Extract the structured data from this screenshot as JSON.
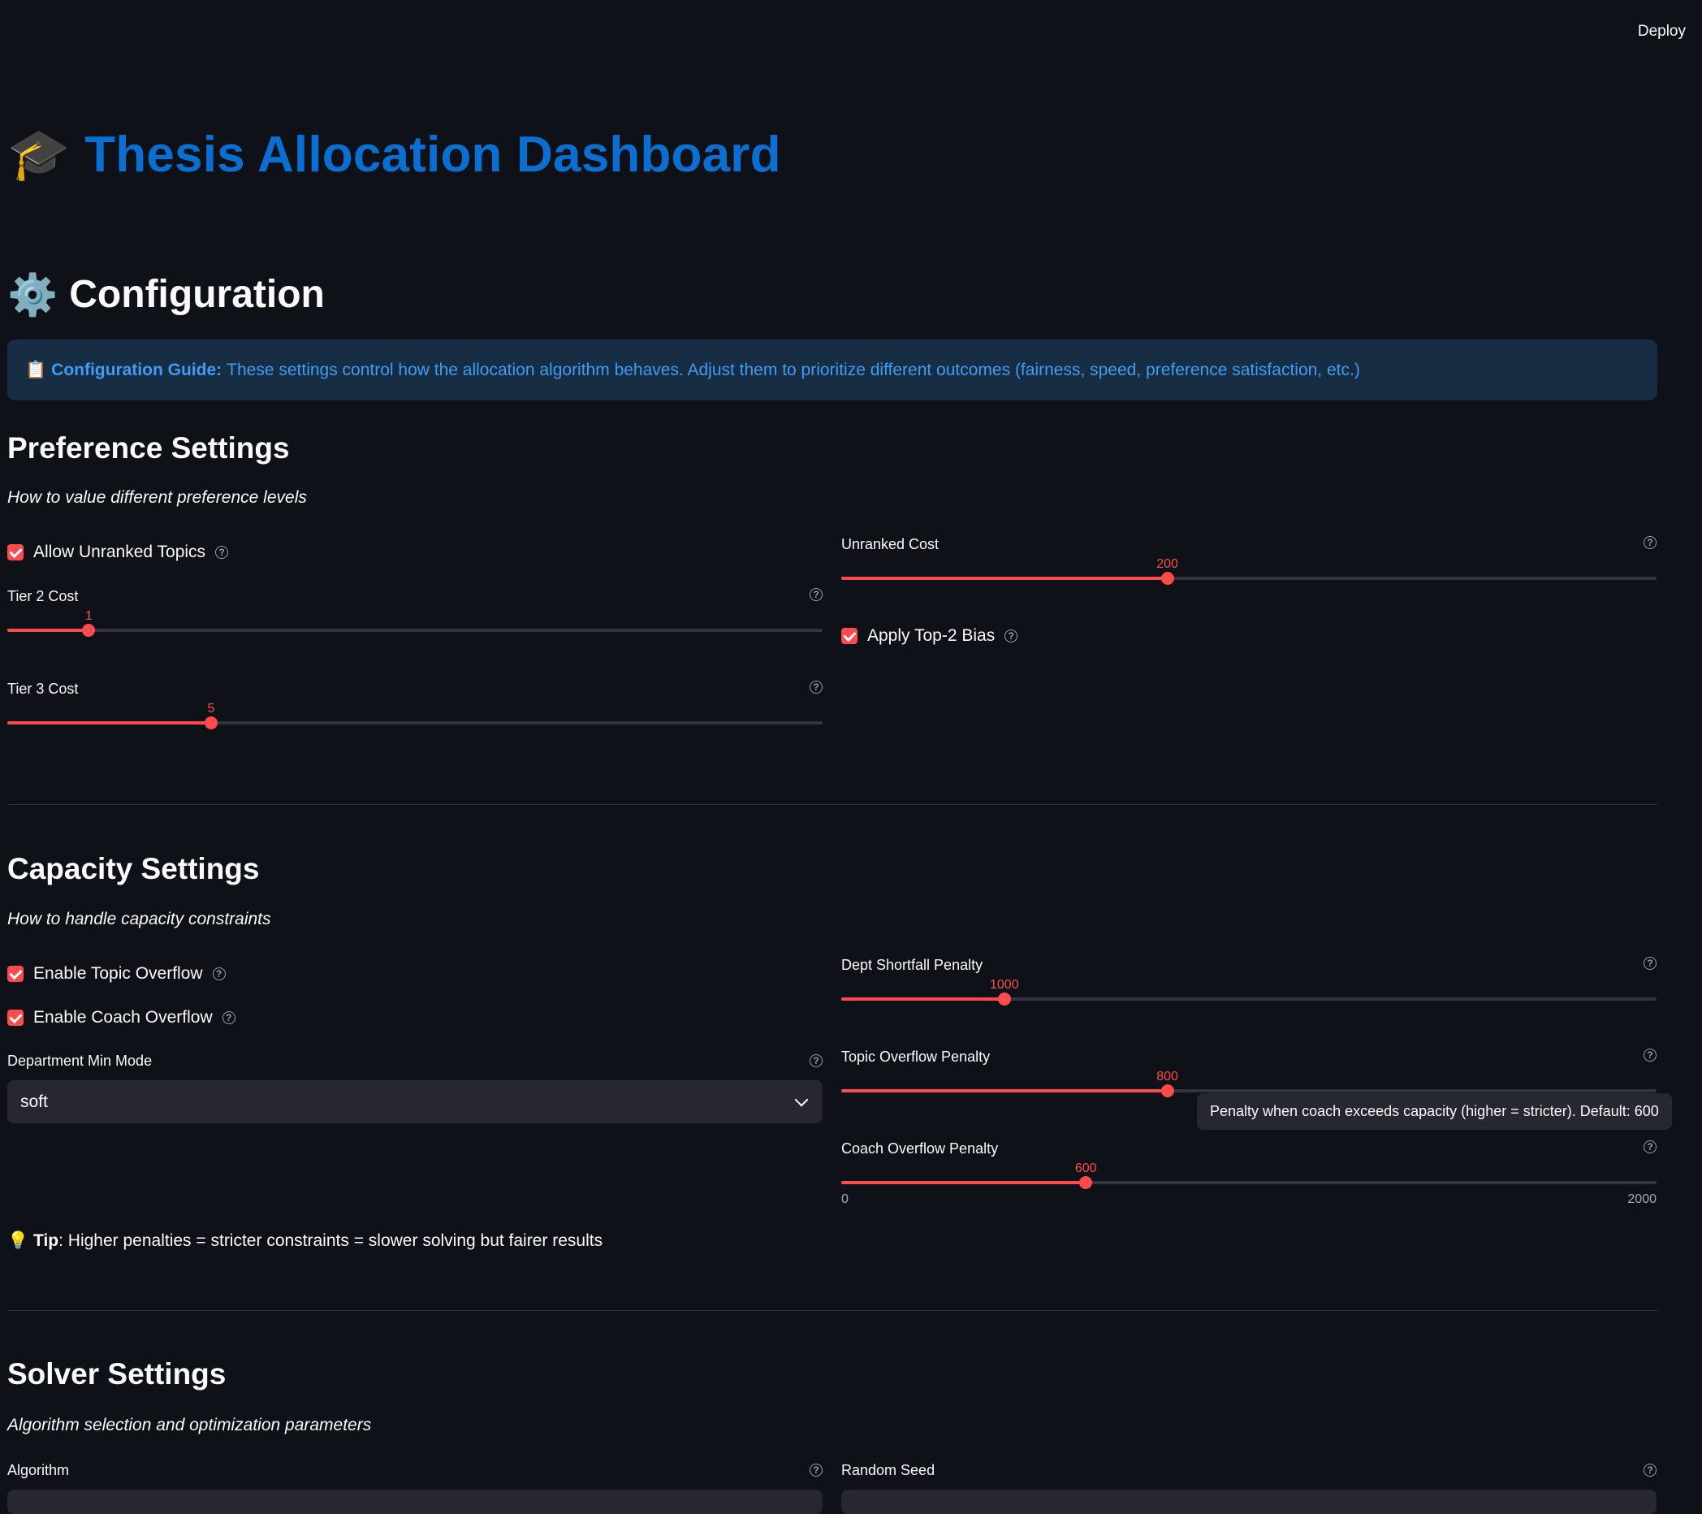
{
  "header": {
    "deploy_label": "Deploy"
  },
  "page": {
    "title_emoji": "🎓",
    "title": "Thesis Allocation Dashboard"
  },
  "configuration": {
    "emoji": "⚙️",
    "heading": "Configuration",
    "info_emoji": "📋",
    "info_bold": "Configuration Guide:",
    "info_text": "These settings control how the allocation algorithm behaves. Adjust them to prioritize different outcomes (fairness, speed, preference satisfaction, etc.)"
  },
  "preference": {
    "heading": "Preference Settings",
    "subtitle": "How to value different preference levels",
    "allow_unranked": {
      "label": "Allow Unranked Topics",
      "checked": true
    },
    "tier2": {
      "label": "Tier 2 Cost",
      "value": 1,
      "fraction": 0.1
    },
    "tier3": {
      "label": "Tier 3 Cost",
      "value": 5,
      "fraction": 0.25
    },
    "unranked_cost": {
      "label": "Unranked Cost",
      "value": 200,
      "fraction": 0.4
    },
    "top2_bias": {
      "label": "Apply Top-2 Bias",
      "checked": true
    }
  },
  "capacity": {
    "heading": "Capacity Settings",
    "subtitle": "How to handle capacity constraints",
    "topic_overflow": {
      "label": "Enable Topic Overflow",
      "checked": true
    },
    "coach_overflow": {
      "label": "Enable Coach Overflow",
      "checked": true
    },
    "dept_min_mode": {
      "label": "Department Min Mode",
      "value": "soft"
    },
    "dept_shortfall": {
      "label": "Dept Shortfall Penalty",
      "value": 1000,
      "fraction": 0.2
    },
    "topic_overflow_penalty": {
      "label": "Topic Overflow Penalty",
      "value": 800,
      "fraction": 0.4
    },
    "coach_overflow_penalty": {
      "label": "Coach Overflow Penalty",
      "value": 600,
      "fraction": 0.3,
      "min": "0",
      "max": "2000"
    },
    "tooltip": "Penalty when coach exceeds capacity (higher = stricter). Default: 600",
    "tip_emoji": "💡",
    "tip_bold": "Tip",
    "tip_text": ": Higher penalties = stricter constraints = slower solving but fairer results"
  },
  "solver": {
    "heading": "Solver Settings",
    "subtitle": "Algorithm selection and optimization parameters",
    "algorithm_label": "Algorithm",
    "seed_label": "Random Seed"
  },
  "colors": {
    "accent": "#ff4b4b",
    "title": "#0a6fd1",
    "background": "#0e1117",
    "info_bg": "#172d43",
    "info_text": "#3d9df3"
  },
  "icons": {
    "help": "question-circle-icon",
    "check": "checkbox-checked-icon",
    "chevron": "chevron-down-icon"
  }
}
